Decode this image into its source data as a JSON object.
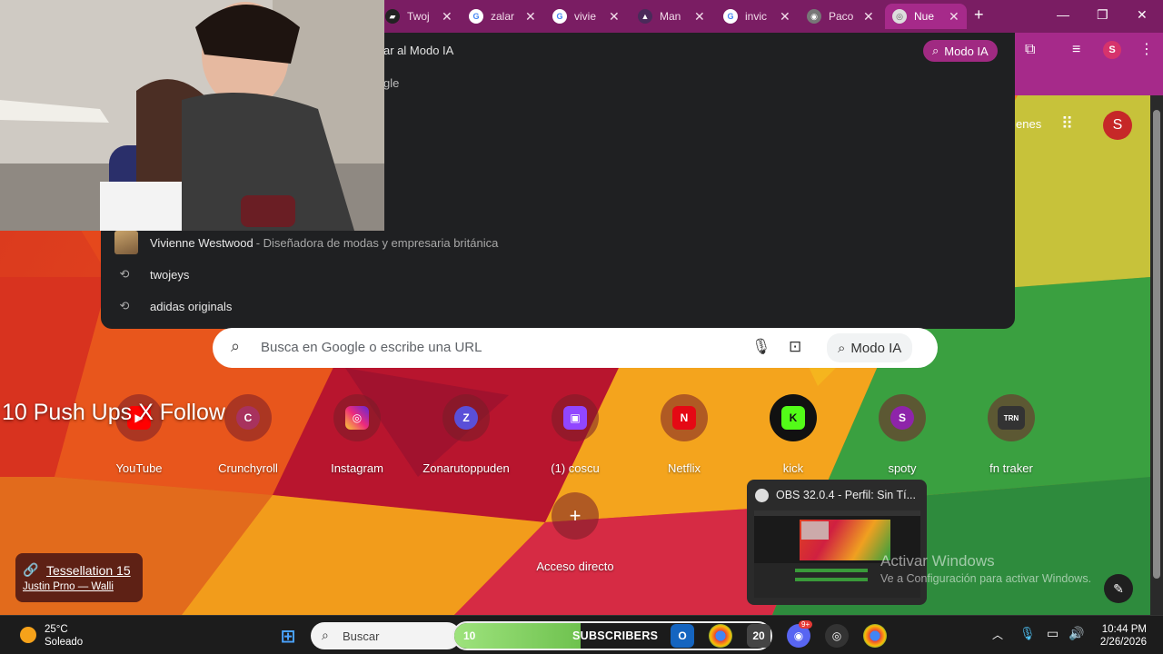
{
  "tabs": [
    {
      "title": "Twoj",
      "icon": "twitch-icon",
      "color": "#6e3aa8"
    },
    {
      "title": "zalar",
      "icon": "google-icon",
      "color": "#4285f4"
    },
    {
      "title": "vivie",
      "icon": "google-icon",
      "color": "#4285f4"
    },
    {
      "title": "Man",
      "icon": "app-icon",
      "color": "#4a2a5a"
    },
    {
      "title": "invic",
      "icon": "google-icon",
      "color": "#4285f4"
    },
    {
      "title": "Paco",
      "icon": "app-icon",
      "color": "#666666"
    },
    {
      "title": "Nue",
      "icon": "chrome-icon",
      "color": "#cccccc"
    }
  ],
  "omnibox": {
    "ai_hint": "ar al Modo IA",
    "google_hint": "gle",
    "modo_ia": "Modo IA",
    "suggestions": [
      {
        "text": "Vivienne Westwood",
        "desc": "- Diseñadora de modas y empresaria británica",
        "kind": "entity"
      },
      {
        "text": "twojeys",
        "kind": "history"
      },
      {
        "text": "adidas originals",
        "kind": "history"
      }
    ]
  },
  "header": {
    "right_partial": "enes",
    "profile_letter": "S"
  },
  "search": {
    "placeholder": "Busca en Google o escribe una URL",
    "modo_ia": "Modo IA"
  },
  "shortcuts": [
    {
      "label": "YouTube",
      "glyph": "▶",
      "color": "#ff0000"
    },
    {
      "label": "Crunchyroll",
      "glyph": "C",
      "color": "#a8325e"
    },
    {
      "label": "Instagram",
      "glyph": "◎",
      "color": "#d6249f"
    },
    {
      "label": "Zonarutoppuden",
      "glyph": "Z",
      "color": "#5a4fd8"
    },
    {
      "label": "(1) coscu",
      "glyph": "▣",
      "color": "#9146ff"
    },
    {
      "label": "Netflix",
      "glyph": "N",
      "color": "#e50914"
    },
    {
      "label": "kick",
      "glyph": "K",
      "color": "#53fc18"
    },
    {
      "label": "spoty",
      "glyph": "S",
      "color": "#8e24aa"
    },
    {
      "label": "fn traker",
      "glyph": "TRN",
      "color": "#333333"
    }
  ],
  "add_shortcut": {
    "label": "Acceso directo",
    "glyph": "+"
  },
  "overlay_text": "10 Push Ups X Follow",
  "attribution": {
    "title": "Tessellation 15",
    "author": "Justin Prno — Walli"
  },
  "obs": {
    "title": "OBS 32.0.4 - Perfil: Sin Tí..."
  },
  "activate": {
    "line1": "Activar Windows",
    "line2": "Ve a Configuración para activar Windows."
  },
  "taskbar": {
    "weather_temp": "25°C",
    "weather_desc": "Soleado",
    "search_placeholder": "Buscar",
    "subs_count": "10",
    "subs_label": "SUBSCRIBERS",
    "subs_progress": 0.4,
    "time": "10:44 PM",
    "date": "2/26/2026",
    "badges": {
      "discord": "9+",
      "app": "20"
    }
  },
  "colors": {
    "tabstrip": "#7a1d63",
    "toolbar": "#a62a8a",
    "dropdown": "#1f2022",
    "accent": "#c2185b"
  }
}
